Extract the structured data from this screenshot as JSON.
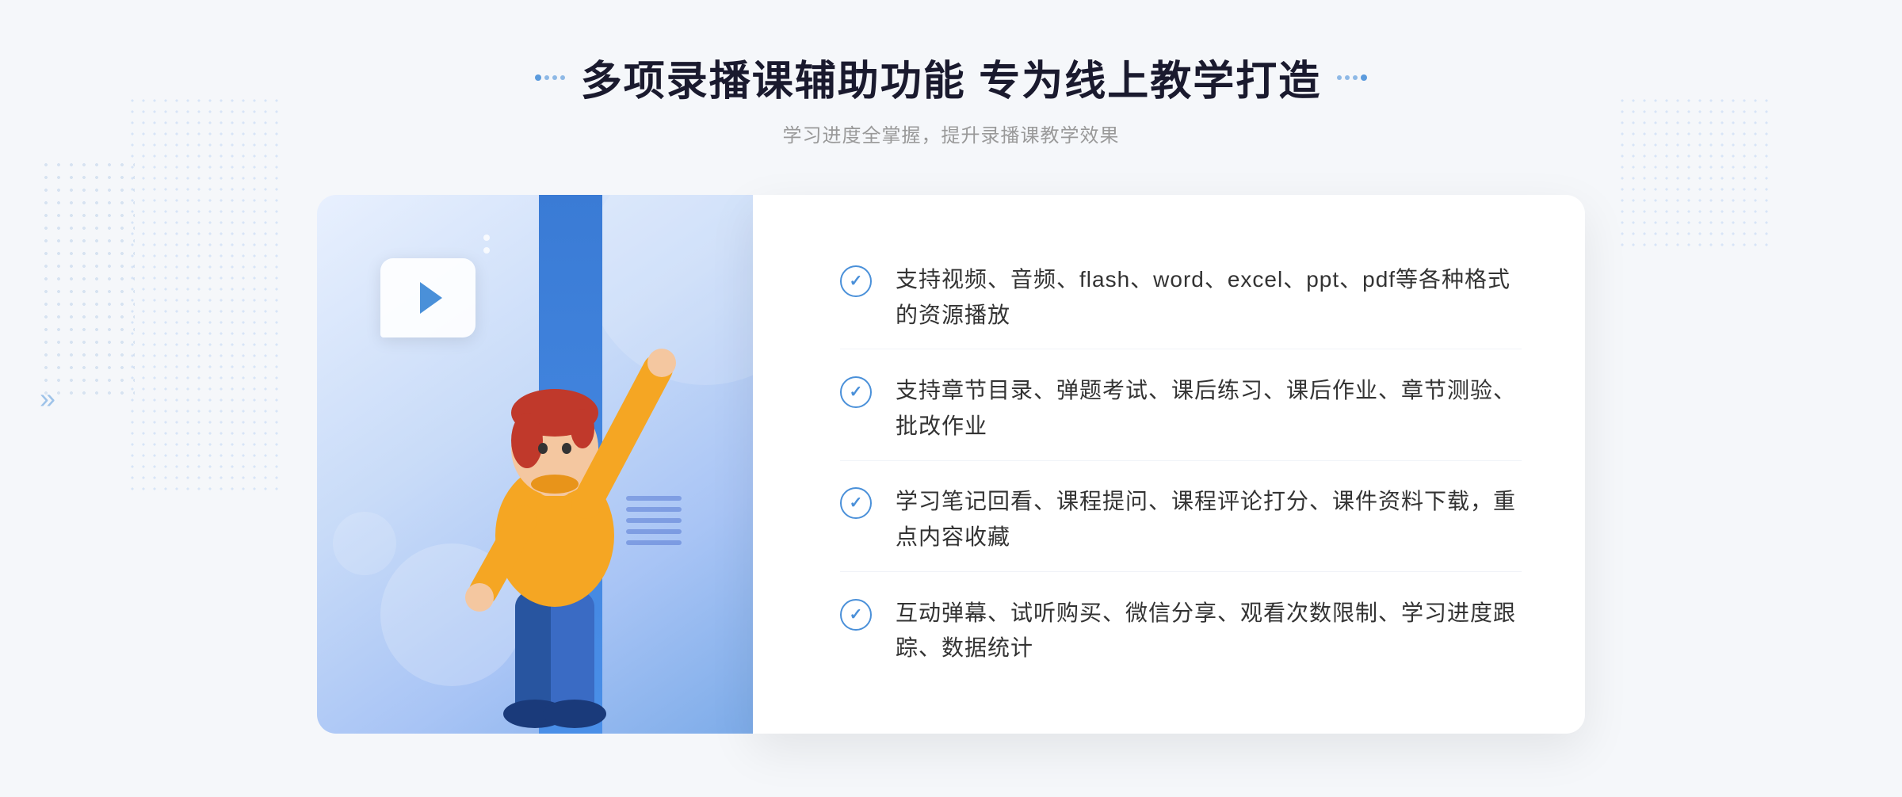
{
  "header": {
    "title": "多项录播课辅助功能 专为线上教学打造",
    "subtitle": "学习进度全掌握，提升录播课教学效果",
    "title_dots_left": "decorative",
    "title_dots_right": "decorative"
  },
  "features": [
    {
      "id": "feature-1",
      "text": "支持视频、音频、flash、word、excel、ppt、pdf等各种格式的资源播放"
    },
    {
      "id": "feature-2",
      "text": "支持章节目录、弹题考试、课后练习、课后作业、章节测验、批改作业"
    },
    {
      "id": "feature-3",
      "text": "学习笔记回看、课程提问、课程评论打分、课件资料下载，重点内容收藏"
    },
    {
      "id": "feature-4",
      "text": "互动弹幕、试听购买、微信分享、观看次数限制、学习进度跟踪、数据统计"
    }
  ],
  "check_icon": "✓",
  "play_icon": "▶",
  "arrows": "»"
}
